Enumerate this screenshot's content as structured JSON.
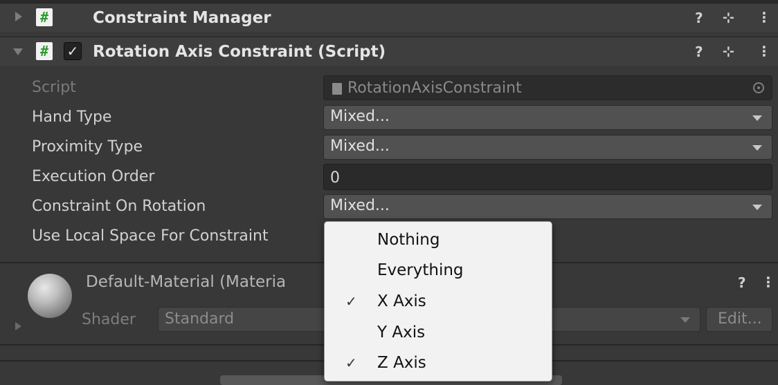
{
  "constraint_manager": {
    "title": "Constraint Manager",
    "icons": {
      "script": "#",
      "help": "?",
      "settings": "⊹",
      "menu": "⋮"
    }
  },
  "rotation_component": {
    "title": "Rotation Axis Constraint (Script)",
    "enabled_check": "✓",
    "fields": {
      "script_label": "Script",
      "script_value": "RotationAxisConstraint",
      "hand_type_label": "Hand Type",
      "hand_type_value": "Mixed...",
      "proximity_type_label": "Proximity Type",
      "proximity_type_value": "Mixed...",
      "execution_order_label": "Execution Order",
      "execution_order_value": "0",
      "constraint_on_rotation_label": "Constraint On Rotation",
      "constraint_on_rotation_value": "Mixed...",
      "use_local_space_label": "Use Local Space For Constraint"
    }
  },
  "material": {
    "title": "Default-Material (Materia",
    "shader_label": "Shader",
    "shader_value": "Standard",
    "edit_button": "Edit..."
  },
  "popup_menu": {
    "items": [
      {
        "label": "Nothing",
        "checked": false
      },
      {
        "label": "Everything",
        "checked": false
      },
      {
        "label": "X Axis",
        "checked": true,
        "check_glyph": "✓"
      },
      {
        "label": "Y Axis",
        "checked": false
      },
      {
        "label": "Z Axis",
        "checked": true,
        "check_glyph": "✓"
      }
    ]
  },
  "colors": {
    "inspector_bg": "#383838",
    "header_bg": "#3e3e3e",
    "dropdown_bg": "#515151",
    "popup_bg": "#f2f2f2"
  }
}
